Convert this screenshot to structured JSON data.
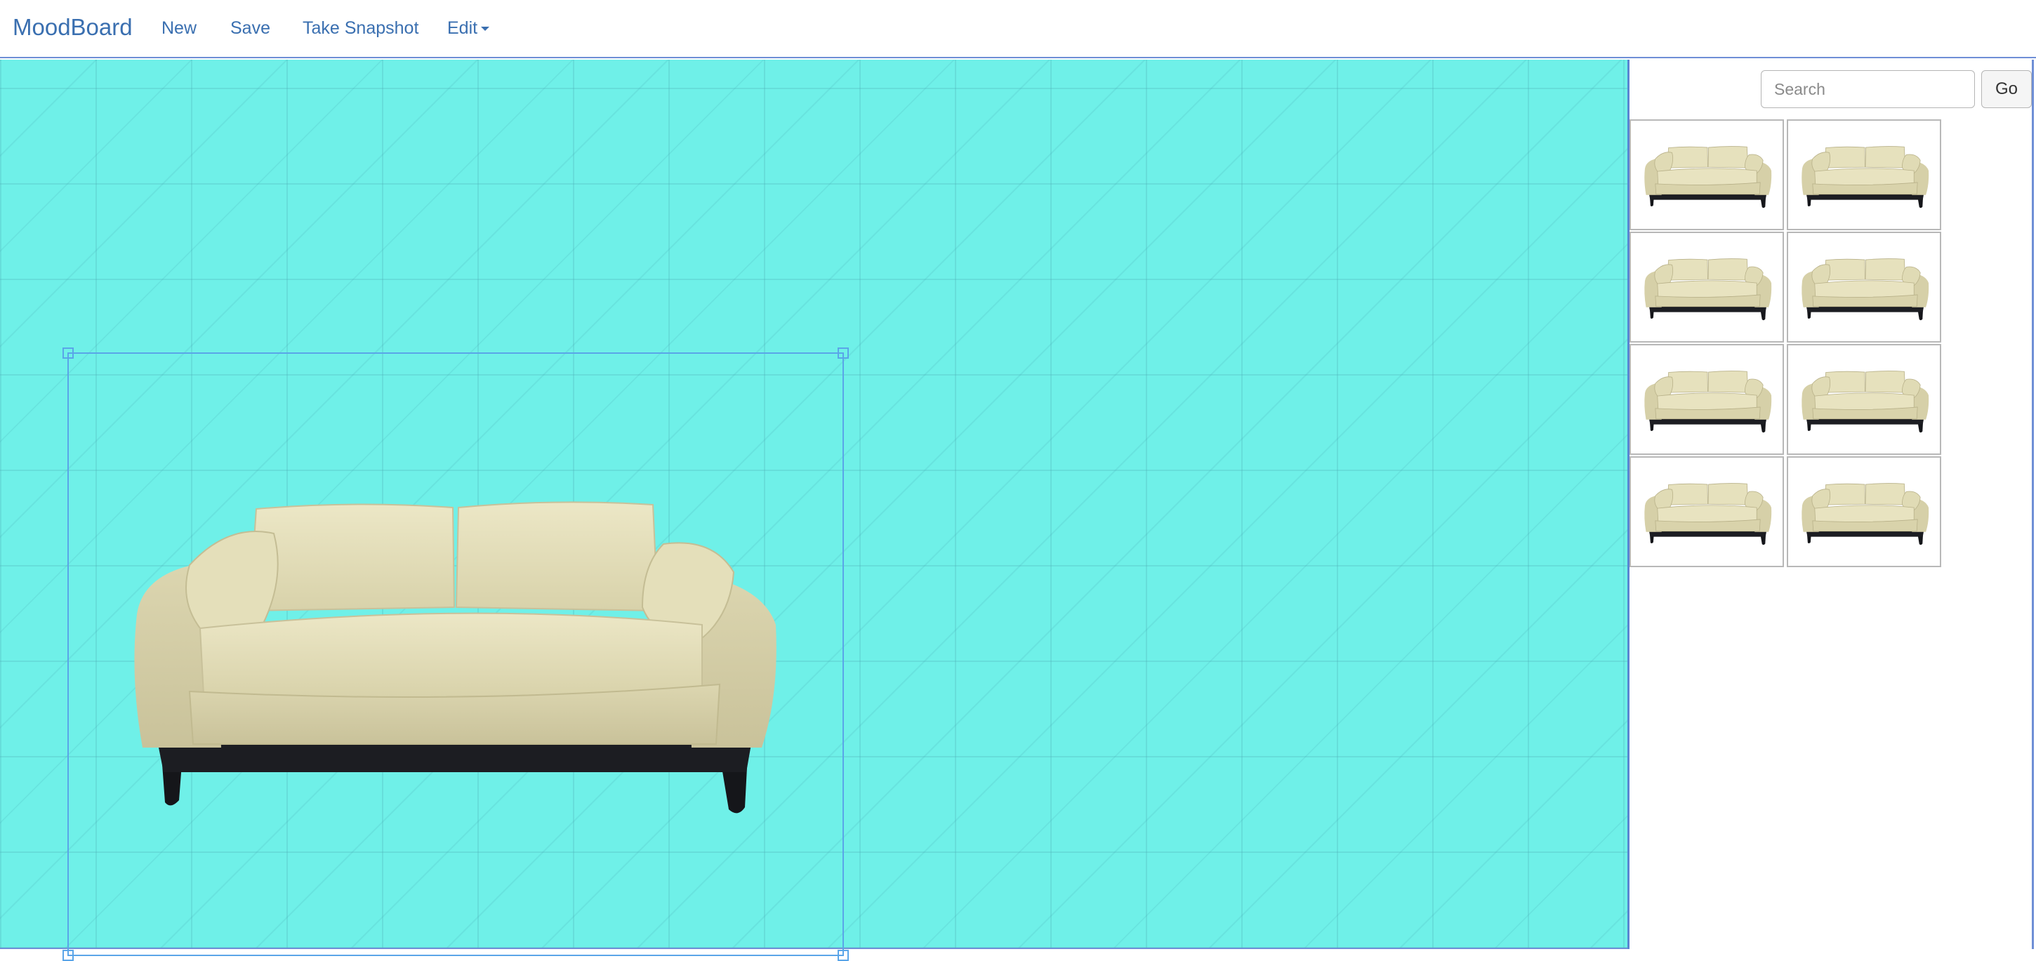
{
  "navbar": {
    "brand": "MoodBoard",
    "items": [
      {
        "label": "New"
      },
      {
        "label": "Save"
      },
      {
        "label": "Take Snapshot"
      },
      {
        "label": "Edit"
      }
    ]
  },
  "canvas": {
    "background_color": "#6ff0e8",
    "selection_color": "#5aa5e8",
    "item": {
      "icon": "sofa-icon"
    }
  },
  "sidebar": {
    "search": {
      "placeholder": "Search",
      "value": ""
    },
    "go_label": "Go",
    "results_count": 8,
    "result_icon": "sofa-icon"
  },
  "colors": {
    "link": "#3a6fb0",
    "sofa_fabric": "#e6e1bd",
    "sofa_base": "#1c1d22"
  }
}
